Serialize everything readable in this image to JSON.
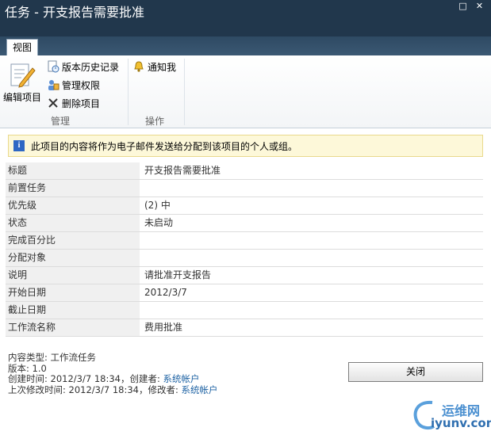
{
  "window": {
    "title": "任务 - 开支报告需要批准",
    "maximize_glyph": "□",
    "close_glyph": "✕"
  },
  "ribbon": {
    "tab_view": "视图",
    "edit_item": "编辑项目",
    "version_history": "版本历史记录",
    "manage_permissions": "管理权限",
    "delete_item": "删除项目",
    "alert_me": "通知我",
    "group_manage": "管理",
    "group_actions": "操作"
  },
  "info_message": "此项目的内容将作为电子邮件发送给分配到该项目的个人或组。",
  "info_icon": "i",
  "fields": [
    {
      "label": "标题",
      "value": "开支报告需要批准"
    },
    {
      "label": "前置任务",
      "value": ""
    },
    {
      "label": "优先级",
      "value": "(2) 中"
    },
    {
      "label": "状态",
      "value": "未启动"
    },
    {
      "label": "完成百分比",
      "value": ""
    },
    {
      "label": "分配对象",
      "value": ""
    },
    {
      "label": "说明",
      "value": "请批准开支报告"
    },
    {
      "label": "开始日期",
      "value": "2012/3/7"
    },
    {
      "label": "截止日期",
      "value": ""
    },
    {
      "label": "工作流名称",
      "value": "费用批准"
    }
  ],
  "meta": {
    "content_type": "内容类型: 工作流任务",
    "version": "版本: 1.0",
    "created_prefix": "创建时间: 2012/3/7 18:34，创建者: ",
    "created_by": "系统帐户",
    "modified_prefix": "上次修改时间: 2012/3/7 18:34，修改者: ",
    "modified_by": "系统帐户"
  },
  "close_button": "关闭",
  "watermark": {
    "cn": "运维网",
    "en": "iyunv.com"
  },
  "colors": {
    "titlebar": "#21374c",
    "link": "#1f63a4",
    "info_bg": "#fdf8d9"
  }
}
